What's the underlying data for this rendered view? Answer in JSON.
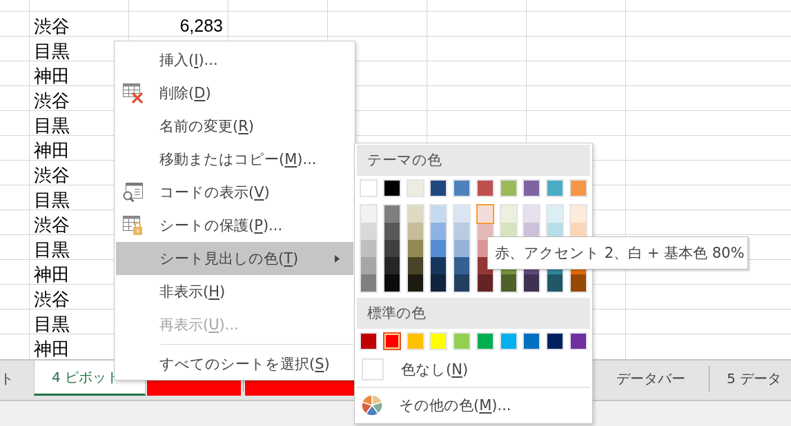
{
  "sheet": {
    "rows": [
      {
        "area": "渋谷",
        "value": "6,283"
      },
      {
        "area": "目黒"
      },
      {
        "area": "神田"
      },
      {
        "area": "渋谷"
      },
      {
        "area": "目黒"
      },
      {
        "area": "神田"
      },
      {
        "area": "渋谷"
      },
      {
        "area": "目黒"
      },
      {
        "area": "渋谷"
      },
      {
        "area": "目黒"
      },
      {
        "area": "神田"
      },
      {
        "area": "渋谷"
      },
      {
        "area": "目黒"
      },
      {
        "area": "神田"
      }
    ]
  },
  "sheet_tabs": [
    {
      "label": "ト",
      "selected": false
    },
    {
      "label": "4 ピボット",
      "selected": true
    },
    {
      "color": "#ff0000",
      "selected": false
    },
    {
      "color": "#ff0000",
      "selected": false
    },
    {
      "label": "データバー",
      "selected": false
    },
    {
      "label": "5 データ",
      "selected": false
    }
  ],
  "context_menu": {
    "groups": [
      [
        {
          "kind": "command",
          "label_start": "挿入(",
          "access_key": "I",
          "label_end": ")...",
          "selected": false,
          "disabled": false
        },
        {
          "kind": "delete",
          "label_start": "削除(",
          "access_key": "D",
          "label_end": ")",
          "selected": false,
          "disabled": false
        },
        {
          "kind": "command",
          "label_start": "名前の変更(",
          "access_key": "R",
          "label_end": ")",
          "selected": false,
          "disabled": false
        },
        {
          "kind": "command",
          "label_start": "移動またはコピー(",
          "access_key": "M",
          "label_end": ")...",
          "selected": false,
          "disabled": false
        },
        {
          "kind": "code",
          "label_start": "コードの表示(",
          "access_key": "V",
          "label_end": ")",
          "selected": false,
          "disabled": false
        },
        {
          "kind": "protect",
          "label_start": "シートの保護(",
          "access_key": "P",
          "label_end": ")...",
          "selected": false,
          "disabled": false
        },
        {
          "kind": "submenu",
          "label_start": "シート見出しの色(",
          "access_key": "T",
          "label_end": ")",
          "selected": true,
          "disabled": false
        },
        {
          "kind": "command",
          "label_start": "非表示(",
          "access_key": "H",
          "label_end": ")",
          "selected": false,
          "disabled": false
        },
        {
          "kind": "command",
          "label_start": "再表示(",
          "access_key": "U",
          "label_end": ")...",
          "selected": false,
          "disabled": true
        }
      ],
      [
        {
          "kind": "command",
          "label_start": "すべてのシートを選択(",
          "access_key": "S",
          "label_end": ")",
          "selected": false,
          "disabled": false
        }
      ]
    ]
  },
  "tab_color_menu": {
    "theme_heading": "テーマの色",
    "theme_colors": [
      {
        "color": "#ffffff",
        "hovered": false
      },
      {
        "color": "#000000",
        "hovered": false
      },
      {
        "color": "#eeece1",
        "hovered": false
      },
      {
        "color": "#1f497d",
        "hovered": false
      },
      {
        "color": "#4f81bd",
        "hovered": false
      },
      {
        "color": "#c0504d",
        "hovered": false
      },
      {
        "color": "#9bbb59",
        "hovered": false
      },
      {
        "color": "#8064a2",
        "hovered": false
      },
      {
        "color": "#4bacc6",
        "hovered": false
      },
      {
        "color": "#f79646",
        "hovered": false
      }
    ],
    "theme_shades": [
      [
        {
          "color": "#f2f2f2",
          "hovered": false
        },
        {
          "color": "#7f7f7f",
          "hovered": false
        },
        {
          "color": "#ddd9c3",
          "hovered": false
        },
        {
          "color": "#c6d9f0",
          "hovered": false
        },
        {
          "color": "#dbe5f1",
          "hovered": false
        },
        {
          "color": "#f2dcdb",
          "hovered": true
        },
        {
          "color": "#ebf1dd",
          "hovered": false
        },
        {
          "color": "#e5e0ec",
          "hovered": false
        },
        {
          "color": "#dbeef3",
          "hovered": false
        },
        {
          "color": "#fdeada",
          "hovered": false
        }
      ],
      [
        {
          "color": "#d9d9d9",
          "hovered": false
        },
        {
          "color": "#595959",
          "hovered": false
        },
        {
          "color": "#c4bd97",
          "hovered": false
        },
        {
          "color": "#8db3e2",
          "hovered": false
        },
        {
          "color": "#b8cce4",
          "hovered": false
        },
        {
          "color": "#e5b9b7",
          "hovered": false
        },
        {
          "color": "#d7e3bc",
          "hovered": false
        },
        {
          "color": "#ccc1d9",
          "hovered": false
        },
        {
          "color": "#b7dde8",
          "hovered": false
        },
        {
          "color": "#fbd5b5",
          "hovered": false
        }
      ],
      [
        {
          "color": "#bfbfbf",
          "hovered": false
        },
        {
          "color": "#3f3f3f",
          "hovered": false
        },
        {
          "color": "#938953",
          "hovered": false
        },
        {
          "color": "#548dd4",
          "hovered": false
        },
        {
          "color": "#95b3d7",
          "hovered": false
        },
        {
          "color": "#d99694",
          "hovered": false
        }
      ],
      [
        {
          "color": "#a6a6a6",
          "hovered": false
        },
        {
          "color": "#262626",
          "hovered": false
        },
        {
          "color": "#494429",
          "hovered": false
        },
        {
          "color": "#17365d",
          "hovered": false
        },
        {
          "color": "#366092",
          "hovered": false
        },
        {
          "color": "#953734",
          "hovered": false
        },
        {
          "color": "#76923c",
          "hovered": false
        },
        {
          "color": "#5f497a",
          "hovered": false
        },
        {
          "color": "#31859b",
          "hovered": false
        },
        {
          "color": "#e36c09",
          "hovered": false
        }
      ],
      [
        {
          "color": "#808080",
          "hovered": false
        },
        {
          "color": "#0c0c0c",
          "hovered": false
        },
        {
          "color": "#1d1b10",
          "hovered": false
        },
        {
          "color": "#0f243e",
          "hovered": false
        },
        {
          "color": "#244061",
          "hovered": false
        },
        {
          "color": "#632423",
          "hovered": false
        },
        {
          "color": "#4f6128",
          "hovered": false
        },
        {
          "color": "#3f3151",
          "hovered": false
        },
        {
          "color": "#205867",
          "hovered": false
        },
        {
          "color": "#974806",
          "hovered": false
        }
      ]
    ],
    "standard_heading": "標準の色",
    "standard_colors": [
      {
        "color": "#c00000",
        "selected": false
      },
      {
        "color": "#ff0000",
        "selected": true
      },
      {
        "color": "#ffc000",
        "selected": false
      },
      {
        "color": "#ffff00",
        "selected": false
      },
      {
        "color": "#92d050",
        "selected": false
      },
      {
        "color": "#00b050",
        "selected": false
      },
      {
        "color": "#00b0f0",
        "selected": false
      },
      {
        "color": "#0070c0",
        "selected": false
      },
      {
        "color": "#002060",
        "selected": false
      },
      {
        "color": "#7030a0",
        "selected": false
      }
    ],
    "no_color": {
      "label_start": "色なし(",
      "access_key": "N",
      "label_end": ")"
    },
    "more_colors": {
      "label_start": "その他の色(",
      "access_key": "M",
      "label_end": ")..."
    }
  },
  "tooltip": "赤、アクセント 2、白 + 基本色 80%"
}
